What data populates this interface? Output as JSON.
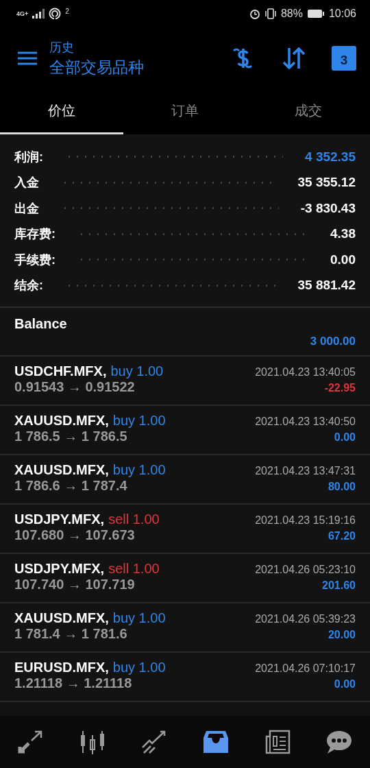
{
  "status_bar": {
    "network": "4G+",
    "hotspot_count": "2",
    "battery": "88%",
    "time": "10:06"
  },
  "header": {
    "subtitle": "历史",
    "title": "全部交易品种",
    "calendar_day": "3"
  },
  "tabs": [
    {
      "label": "价位",
      "selected": true
    },
    {
      "label": "订单",
      "selected": false
    },
    {
      "label": "成交",
      "selected": false
    }
  ],
  "summary": [
    {
      "label": "利润:",
      "value": "4 352.35",
      "color": "#2f86ea"
    },
    {
      "label": "入金",
      "value": "35 355.12",
      "color": "#ffffff"
    },
    {
      "label": "出金",
      "value": "-3 830.43",
      "color": "#ffffff"
    },
    {
      "label": "库存费:",
      "value": "4.38",
      "color": "#ffffff"
    },
    {
      "label": "手续费:",
      "value": "0.00",
      "color": "#ffffff"
    },
    {
      "label": "结余:",
      "value": "35 881.42",
      "color": "#ffffff"
    }
  ],
  "balance": {
    "label": "Balance",
    "amount": "3 000.00"
  },
  "trades": [
    {
      "symbol": "USDCHF.MFX,",
      "kind": "buy",
      "order": "buy 1.00",
      "prices": "0.91543 → 0.91522",
      "time": "2021.04.23 13:40:05",
      "profit": "-22.95",
      "color": "#e0343a"
    },
    {
      "symbol": "XAUUSD.MFX,",
      "kind": "buy",
      "order": "buy 1.00",
      "prices": "1 786.5 → 1 786.5",
      "time": "2021.04.23 13:40:50",
      "profit": "0.00",
      "color": "#2f86ea"
    },
    {
      "symbol": "XAUUSD.MFX,",
      "kind": "buy",
      "order": "buy 1.00",
      "prices": "1 786.6 → 1 787.4",
      "time": "2021.04.23 13:47:31",
      "profit": "80.00",
      "color": "#2f86ea"
    },
    {
      "symbol": "USDJPY.MFX,",
      "kind": "sell",
      "order": "sell 1.00",
      "prices": "107.680 → 107.673",
      "time": "2021.04.23 15:19:16",
      "profit": "67.20",
      "color": "#2f86ea"
    },
    {
      "symbol": "USDJPY.MFX,",
      "kind": "sell",
      "order": "sell 1.00",
      "prices": "107.740 → 107.719",
      "time": "2021.04.26 05:23:10",
      "profit": "201.60",
      "color": "#2f86ea"
    },
    {
      "symbol": "XAUUSD.MFX,",
      "kind": "buy",
      "order": "buy 1.00",
      "prices": "1 781.4 → 1 781.6",
      "time": "2021.04.26 05:39:23",
      "profit": "20.00",
      "color": "#2f86ea"
    },
    {
      "symbol": "EURUSD.MFX,",
      "kind": "buy",
      "order": "buy 1.00",
      "prices": "1.21118 → 1.21118",
      "time": "2021.04.26 07:10:17",
      "profit": "0.00",
      "color": "#2f86ea"
    }
  ],
  "bottom_nav": [
    {
      "kind": "quotes",
      "selected": false
    },
    {
      "kind": "chart",
      "selected": false
    },
    {
      "kind": "trade",
      "selected": false
    },
    {
      "kind": "history",
      "selected": true
    },
    {
      "kind": "news",
      "selected": false
    },
    {
      "kind": "chat",
      "selected": false
    }
  ]
}
